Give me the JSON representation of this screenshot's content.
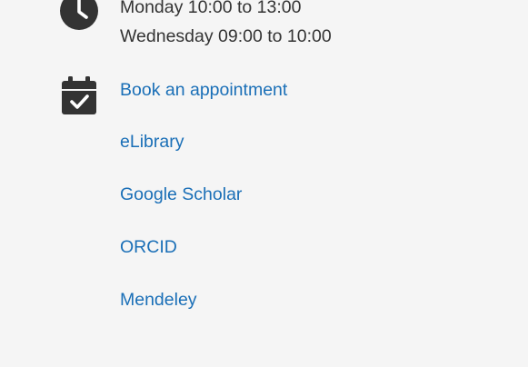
{
  "office_hours": {
    "line_1": "Monday 10:00 to 13:00",
    "line_2": "Wednesday 09:00 to 10:00"
  },
  "links": {
    "book": "Book an appointment",
    "elibrary": "eLibrary",
    "google_scholar": "Google Scholar",
    "orcid": "ORCID",
    "mendeley": "Mendeley"
  },
  "colors": {
    "link": "#1a6fb7",
    "text": "#333333",
    "icon": "#333333",
    "background": "#f5f5f5"
  },
  "icons": {
    "hours": "clock-icon",
    "appointment": "calendar-check-icon"
  }
}
